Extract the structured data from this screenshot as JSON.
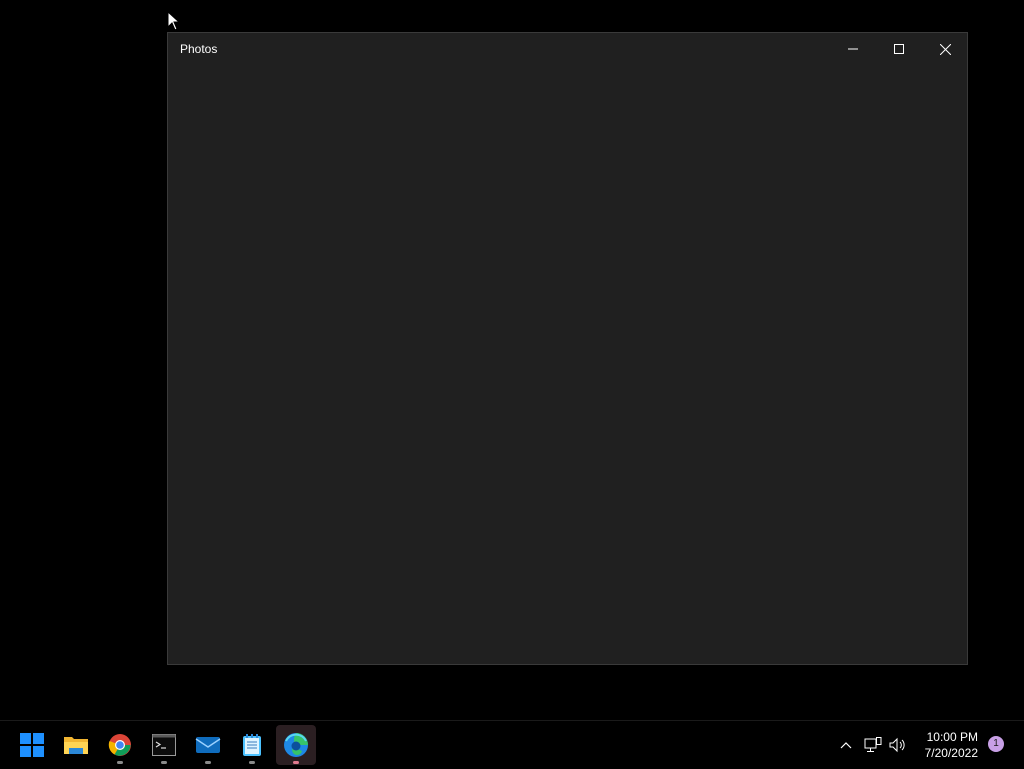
{
  "window": {
    "title": "Photos",
    "controls": {
      "minimize": "minimize",
      "maximize": "maximize",
      "close": "close"
    }
  },
  "taskbar": {
    "items": [
      {
        "name": "start",
        "icon": "windows-logo-icon",
        "active": false
      },
      {
        "name": "file-explorer",
        "icon": "folder-icon",
        "active": false
      },
      {
        "name": "chrome",
        "icon": "chrome-icon",
        "active": false
      },
      {
        "name": "terminal",
        "icon": "terminal-icon",
        "active": false
      },
      {
        "name": "mail",
        "icon": "mail-icon",
        "active": false
      },
      {
        "name": "notepad",
        "icon": "notepad-icon",
        "active": false
      },
      {
        "name": "edge",
        "icon": "edge-icon",
        "active": true
      }
    ],
    "tray": {
      "time": "10:00 PM",
      "date": "7/20/2022",
      "notification_count": "1"
    }
  },
  "colors": {
    "desktop_bg": "#000000",
    "window_bg": "#202020",
    "accent_windows": "#1e90ff",
    "badge": "#c8a0e6"
  }
}
